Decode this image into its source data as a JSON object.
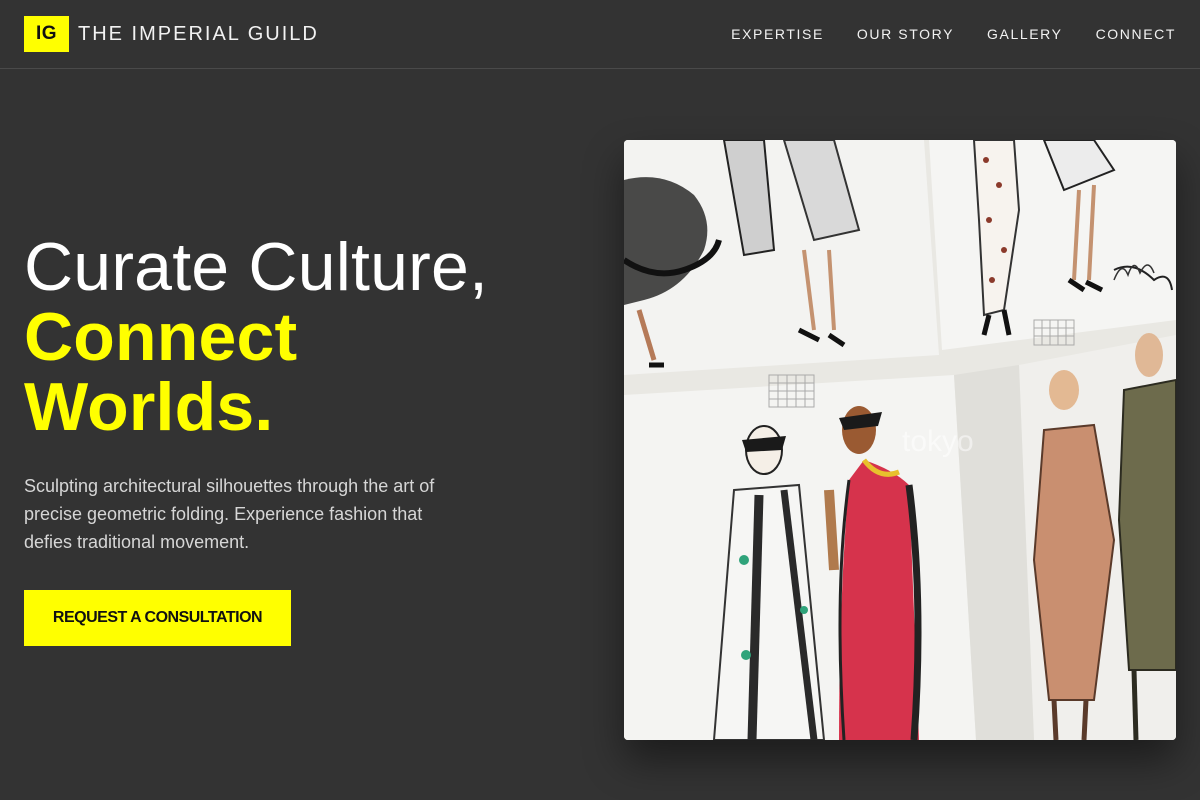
{
  "brand": {
    "logo_initials": "IG",
    "name": "THE IMPERIAL GUILD"
  },
  "nav": {
    "items": [
      {
        "label": "EXPERTISE"
      },
      {
        "label": "OUR STORY"
      },
      {
        "label": "GALLERY"
      },
      {
        "label": "CONNECT"
      }
    ]
  },
  "hero": {
    "headline_line1": "Curate Culture,",
    "headline_line2": "Connect",
    "headline_line3": "Worlds.",
    "subtext": "Sculpting architectural silhouettes through the art of precise geometric folding. Experience fashion that defies traditional movement.",
    "cta_label": "REQUEST A CONSULTATION",
    "image_watermark": "tokyo"
  },
  "colors": {
    "background": "#333333",
    "accent": "#ffff00",
    "text": "#ffffff",
    "muted_text": "#d6d6d6"
  }
}
